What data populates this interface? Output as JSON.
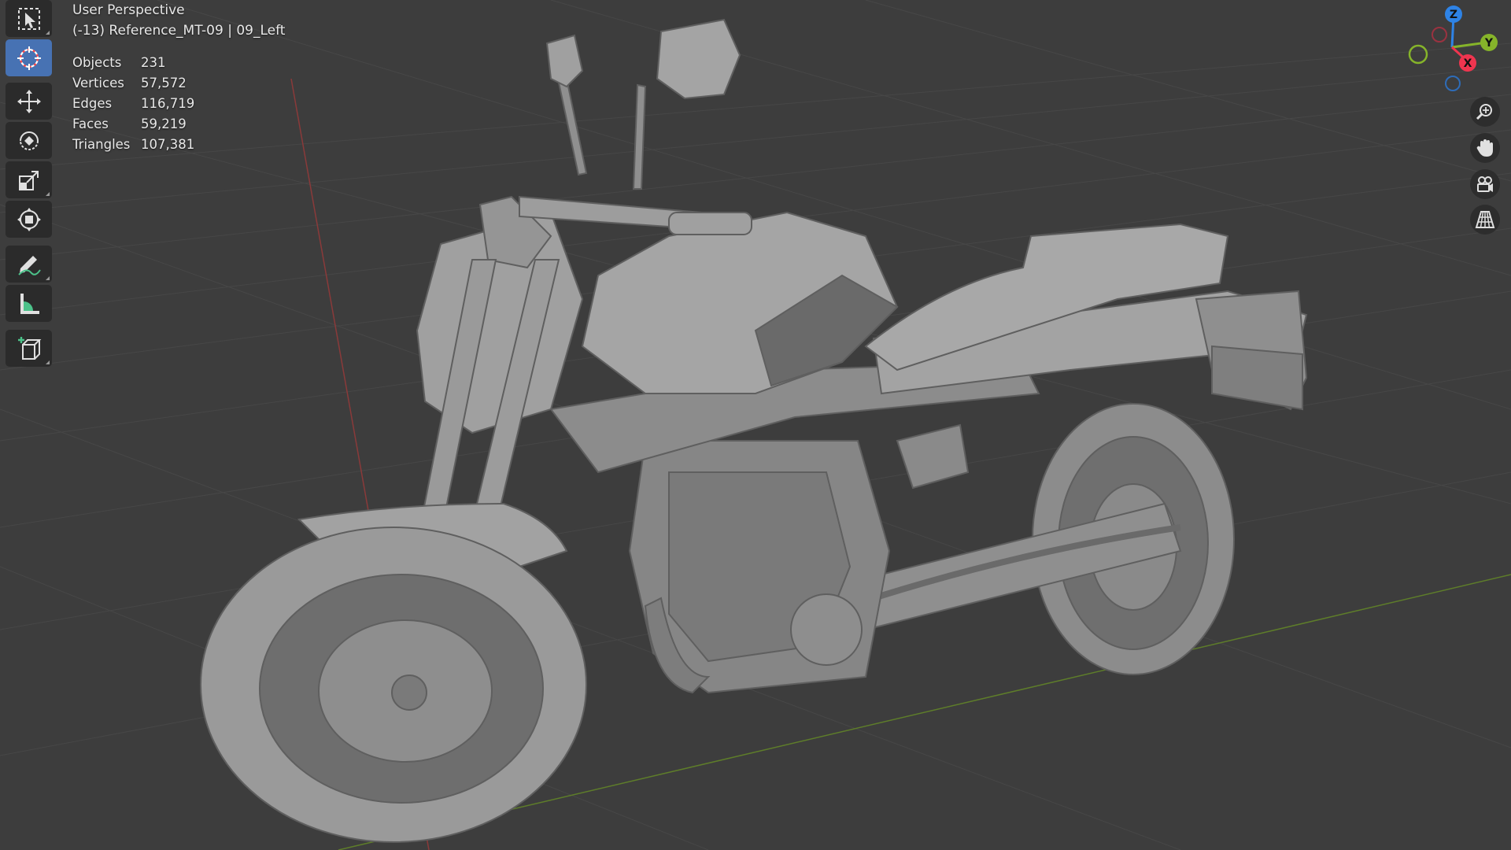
{
  "viewport": {
    "view_name": "User Perspective",
    "collection": "(-13) Reference_MT-09 | 09_Left"
  },
  "stats": [
    {
      "label": "Objects",
      "value": "231"
    },
    {
      "label": "Vertices",
      "value": "57,572"
    },
    {
      "label": "Edges",
      "value": "116,719"
    },
    {
      "label": "Faces",
      "value": "59,219"
    },
    {
      "label": "Triangles",
      "value": "107,381"
    }
  ],
  "toolbar": {
    "tools": [
      {
        "name": "select-box-tool",
        "icon": "select-box-icon",
        "active": false
      },
      {
        "name": "cursor-tool",
        "icon": "cursor-icon",
        "active": true
      },
      {
        "name": "move-tool",
        "icon": "move-icon",
        "active": false
      },
      {
        "name": "rotate-tool",
        "icon": "rotate-icon",
        "active": false
      },
      {
        "name": "scale-tool",
        "icon": "scale-icon",
        "active": false
      },
      {
        "name": "transform-tool",
        "icon": "transform-icon",
        "active": false
      },
      {
        "name": "annotate-tool",
        "icon": "annotate-icon",
        "active": false
      },
      {
        "name": "measure-tool",
        "icon": "measure-icon",
        "active": false
      },
      {
        "name": "add-cube-tool",
        "icon": "add-cube-icon",
        "active": false
      }
    ]
  },
  "gizmo": {
    "x_label": "X",
    "y_label": "Y",
    "z_label": "Z"
  },
  "nav_buttons": [
    {
      "name": "zoom-button",
      "icon": "zoom-icon"
    },
    {
      "name": "pan-button",
      "icon": "hand-icon"
    },
    {
      "name": "camera-view-button",
      "icon": "camera-icon"
    },
    {
      "name": "perspective-toggle-button",
      "icon": "grid-icon"
    }
  ],
  "colors": {
    "background": "#3d3d3d",
    "active_tool": "#4772b3",
    "axis_x": "#f0354f",
    "axis_y": "#86b42a",
    "axis_z": "#2e83e6",
    "model": "#9a9a9a"
  }
}
